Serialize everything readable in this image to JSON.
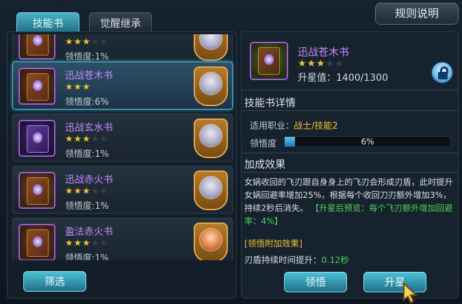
{
  "tabs": [
    {
      "label": "技能书",
      "active": true
    },
    {
      "label": "觉醒继承",
      "active": false
    }
  ],
  "rules_button": "规则说明",
  "skill_books": [
    {
      "name": "",
      "stars": 3,
      "max_stars": 5,
      "comprehension": "领悟度:1%",
      "hero": "white-haired hero",
      "partial": true
    },
    {
      "name": "迅战苍木书",
      "stars": 3,
      "max_stars": 5,
      "comprehension": "领悟度:6%",
      "hero": "white-haired hero",
      "selected": true
    },
    {
      "name": "迅战玄水书",
      "stars": 3,
      "max_stars": 5,
      "comprehension": "领悟度:1%",
      "hero": "white-haired hero"
    },
    {
      "name": "迅战赤火书",
      "stars": 3,
      "max_stars": 5,
      "comprehension": "领悟度:1%",
      "hero": "white-haired hero"
    },
    {
      "name": "盈法赤火书",
      "stars": 3,
      "max_stars": 5,
      "comprehension": "领悟度:1%",
      "hero": "fire-haired hero",
      "partial": true
    }
  ],
  "filter_button": "筛选",
  "detail": {
    "name": "迅战苍木书",
    "stars": 3,
    "max_stars": 5,
    "star_value_label": "升星值：1400/1300",
    "section_details": "技能书详情",
    "job_label": "适用职业：",
    "job_value": "战士/技能2",
    "comprehension_label": "领悟度",
    "comprehension_percent": 6,
    "comprehension_text": "6%",
    "section_bonus": "加成效果",
    "effect_text_main": "女娲收回的飞刃跟自身身上的飞刃会形成刃盾，此时提升女娲回避率增加25%，根据每个收回刀刃额外增加3%，持续2秒后消失。",
    "effect_text_preview": "【升星后预览：每个飞刃额外增加回避率：4%】",
    "sub_title": "[领悟附加效果]",
    "sub_line_prefix": "刃盾持续时间提升：",
    "sub_line_value": "0.12秒",
    "comprehend_button": "领悟",
    "upgrade_button": "升星"
  },
  "colors": {
    "accent": "#4cc0d6",
    "book_name": "#c88bff",
    "star": "#f1c232",
    "green_text": "#4fd25a"
  }
}
